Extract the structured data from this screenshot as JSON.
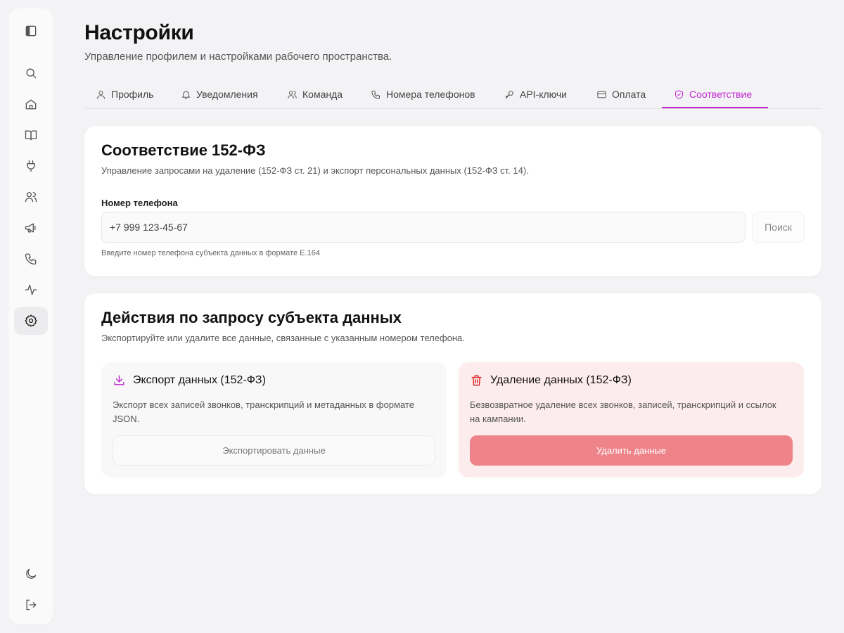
{
  "header": {
    "title": "Настройки",
    "subtitle": "Управление профилем и настройками рабочего пространства."
  },
  "sidebar": {
    "items": [
      {
        "icon": "sidebar-toggle-icon"
      },
      {
        "icon": "search-icon"
      },
      {
        "icon": "home-icon"
      },
      {
        "icon": "book-icon"
      },
      {
        "icon": "plug-icon"
      },
      {
        "icon": "users-icon"
      },
      {
        "icon": "megaphone-icon"
      },
      {
        "icon": "phone-icon"
      },
      {
        "icon": "activity-icon"
      },
      {
        "icon": "gear-icon",
        "active": true
      },
      {
        "icon": "moon-icon"
      },
      {
        "icon": "logout-icon"
      }
    ]
  },
  "tabs": [
    {
      "label": "Профиль",
      "icon": "user-icon"
    },
    {
      "label": "Уведомления",
      "icon": "bell-icon"
    },
    {
      "label": "Команда",
      "icon": "users-icon"
    },
    {
      "label": "Номера телефонов",
      "icon": "phone-icon"
    },
    {
      "label": "API-ключи",
      "icon": "key-icon"
    },
    {
      "label": "Оплата",
      "icon": "credit-card-icon"
    },
    {
      "label": "Соответствие",
      "icon": "shield-icon",
      "active": true
    }
  ],
  "compliance": {
    "title": "Соответствие 152-ФЗ",
    "description": "Управление запросами на удаление (152-ФЗ ст. 21) и экспорт персональных данных (152-ФЗ ст. 14).",
    "phone_label": "Номер телефона",
    "phone_value": "+7  999 123-45-67",
    "search_label": "Поиск",
    "hint": "Введите номер телефона субъекта данных в формате E.164"
  },
  "actions": {
    "title": "Действия по запросу субъекта данных",
    "description": "Экспортируйте или удалите все данные, связанные с указанным номером телефона.",
    "export": {
      "title": "Экспорт данных (152-ФЗ)",
      "description": "Экспорт всех записей звонков, транскрипций и метаданных в формате JSON.",
      "button": "Экспортировать данные"
    },
    "delete": {
      "title": "Удаление данных (152-ФЗ)",
      "description": "Безвозвратное удаление всех звонков, записей, транскрипций и ссылок на кампании.",
      "button": "Удалить данные"
    }
  },
  "colors": {
    "accent": "#c026d3",
    "danger": "#dc2626",
    "danger_button": "#ee8489",
    "danger_bg": "#fdecee"
  }
}
